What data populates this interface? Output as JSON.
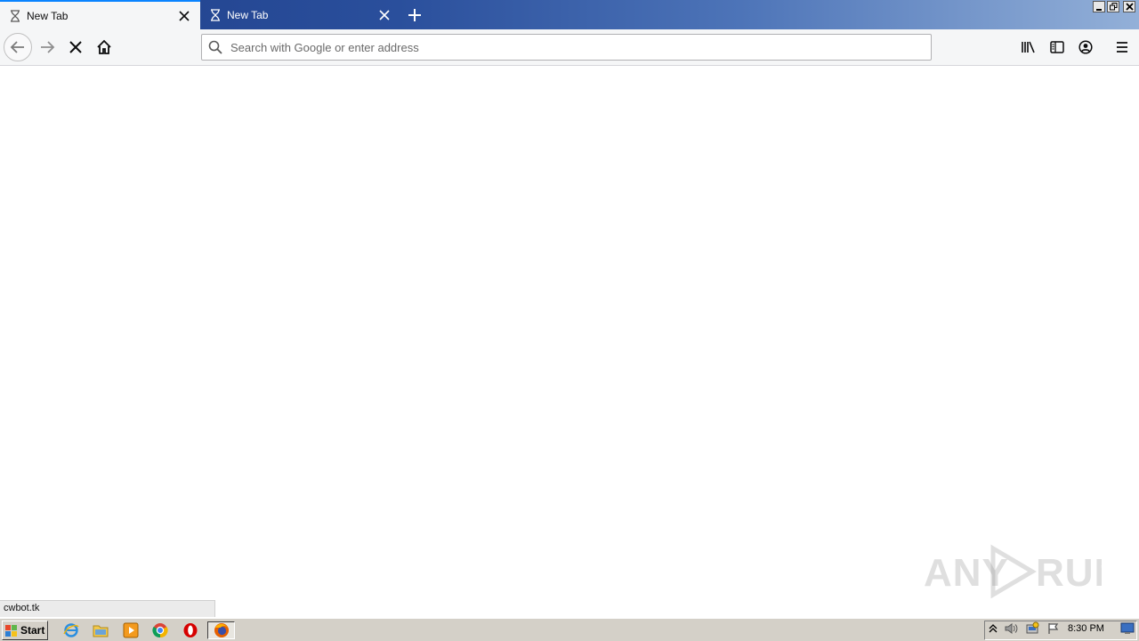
{
  "tabs": [
    {
      "title": "New Tab",
      "active": true
    },
    {
      "title": "New Tab",
      "active": false
    }
  ],
  "urlbar": {
    "placeholder": "Search with Google or enter address",
    "value": ""
  },
  "status": {
    "text": "cwbot.tk"
  },
  "watermark": {
    "text": "ANY RUN"
  },
  "taskbar": {
    "start_label": "Start",
    "clock": "8:30 PM",
    "pinned": [
      "internet-explorer-icon",
      "file-explorer-icon",
      "media-player-icon",
      "chrome-icon",
      "opera-icon",
      "firefox-icon"
    ]
  },
  "colors": {
    "tab_accent": "#0a84ff",
    "titlebar": "#2a4f9c"
  }
}
